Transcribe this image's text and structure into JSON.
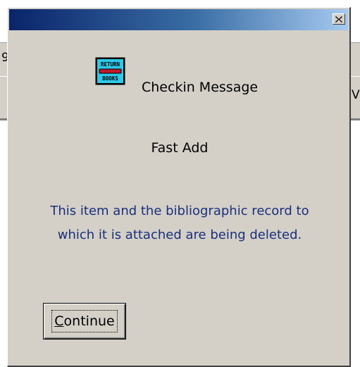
{
  "background": {
    "edge_text_left": "9",
    "edge_text_right": "V"
  },
  "dialog": {
    "title": "",
    "close_label": "×",
    "icon": {
      "name": "return-books-icon",
      "line1": "RETURN",
      "line2": "BOOKS"
    },
    "heading": "Checkin Message",
    "subheading": "Fast Add",
    "message_lines": [
      "This item and the bibliographic record to",
      "which it is attached are being deleted."
    ],
    "continue_button": {
      "accesskey": "C",
      "label_rest": "ontinue"
    }
  },
  "colors": {
    "dialog_face": "#d4d0c8",
    "titlebar_start": "#0a246a",
    "titlebar_end": "#a6caf0",
    "message_text": "#1a2f7a",
    "icon_fill": "#2ec8e8",
    "icon_bar": "#c0182a"
  }
}
